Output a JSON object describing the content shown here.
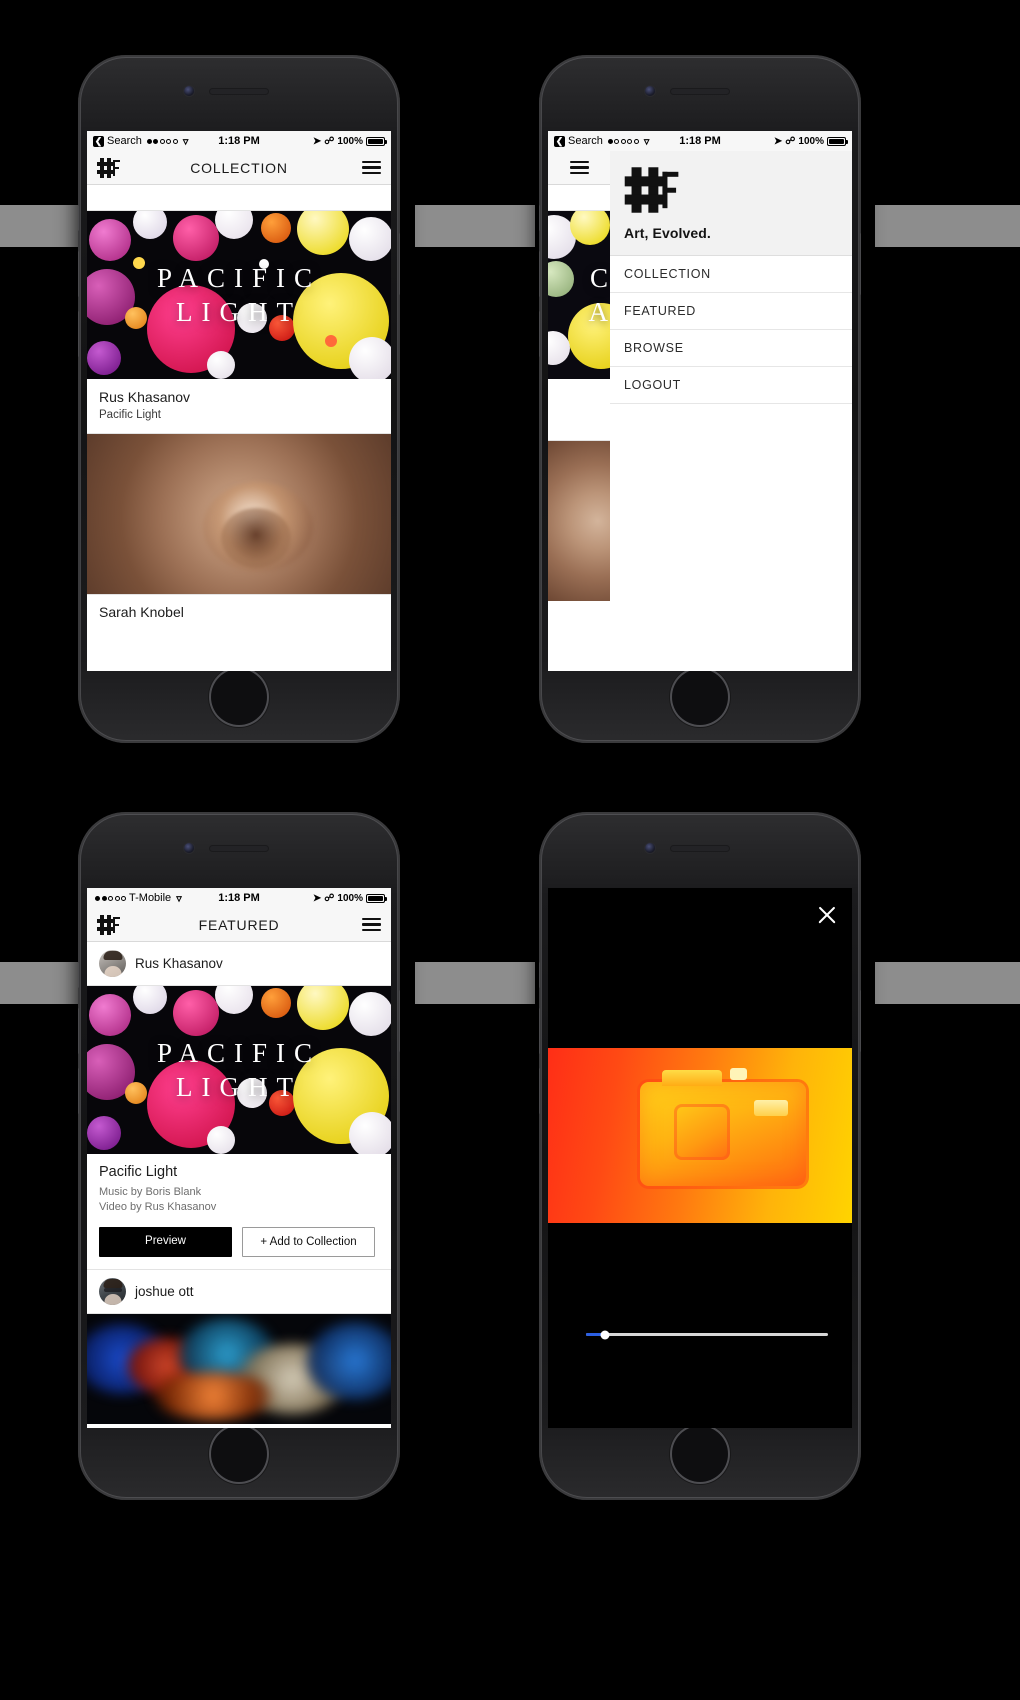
{
  "app": {
    "brand_tagline": "Art, Evolved.",
    "logo_name": "hashtag-logo"
  },
  "phones": {
    "collection": {
      "status": {
        "back_label": "Search",
        "signal_dots_filled": 2,
        "signal_dots_total": 5,
        "wifi": "wifi-icon",
        "time": "1:18 PM",
        "location": "location-arrow-icon",
        "bluetooth": "bluetooth-icon",
        "battery": "100%"
      },
      "navbar": {
        "title": "COLLECTION",
        "menu": "hamburger-icon"
      },
      "cards": [
        {
          "art_title_line1": "PACIFIC",
          "art_title_line2": "LIGHT",
          "author": "Rus Khasanov",
          "work": "Pacific Light"
        },
        {
          "author": "Sarah Knobel"
        }
      ]
    },
    "menu": {
      "status": {
        "back_label": "Search",
        "signal_dots_filled": 1,
        "signal_dots_total": 5,
        "time": "1:18 PM",
        "battery": "100%"
      },
      "peek_letter_1": "C",
      "peek_letter_2": "A",
      "drawer_tagline": "Art, Evolved.",
      "items": [
        {
          "label": "COLLECTION"
        },
        {
          "label": "FEATURED"
        },
        {
          "label": "BROWSE"
        },
        {
          "label": "LOGOUT"
        }
      ]
    },
    "featured": {
      "status": {
        "carrier": "T-Mobile",
        "signal_dots_filled": 2,
        "signal_dots_total": 5,
        "time": "1:18 PM",
        "battery": "100%"
      },
      "navbar": {
        "title": "FEATURED",
        "menu": "hamburger-icon"
      },
      "post_user_top": "Rus Khasanov",
      "art_title_line1": "PACIFIC",
      "art_title_line2": "LIGHT",
      "detail": {
        "title": "Pacific Light",
        "credit_music": "Music by Boris Blank",
        "credit_video": "Video by Rus Khasanov",
        "preview_label": "Preview",
        "add_label": "+ Add to Collection"
      },
      "post_user_bottom": "joshue ott"
    },
    "player": {
      "close_label": "close-icon",
      "progress_percent": 8
    }
  }
}
